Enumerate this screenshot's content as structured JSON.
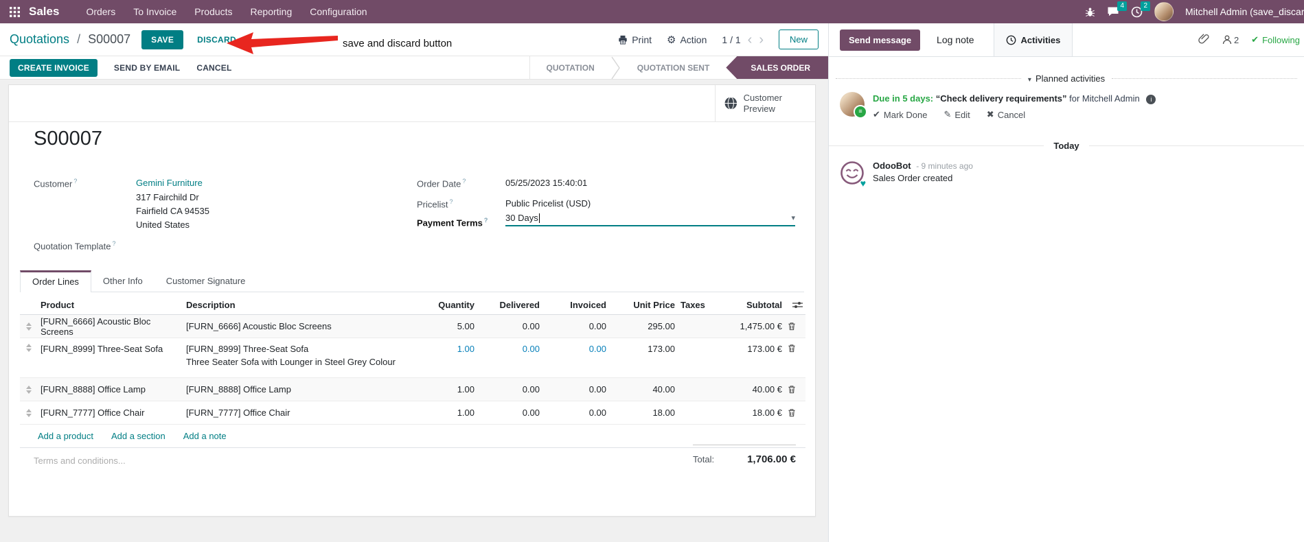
{
  "colors": {
    "brand": "#714B67",
    "accent_teal": "#017E84",
    "badge_teal": "#00A09D",
    "modified_blue": "#0880BA",
    "due_green": "#28a745",
    "arrow_red": "#E8261F"
  },
  "nav": {
    "app": "Sales",
    "menus": [
      "Orders",
      "To Invoice",
      "Products",
      "Reporting",
      "Configuration"
    ],
    "message_badge": "4",
    "activity_badge": "2",
    "user": "Mitchell Admin (save_discar"
  },
  "control": {
    "breadcrumb_parent": "Quotations",
    "breadcrumb_sep": "/",
    "breadcrumb_current": "S00007",
    "save": "SAVE",
    "discard": "DISCARD",
    "print": "Print",
    "action": "Action",
    "pager": "1 / 1",
    "prev": "‹",
    "next": "›",
    "new": "New"
  },
  "annotation": {
    "label": "save and discard button"
  },
  "actions": {
    "create_invoice": "CREATE INVOICE",
    "send_by_email": "SEND BY EMAIL",
    "cancel": "CANCEL"
  },
  "statusbar": {
    "stages": [
      "QUOTATION",
      "QUOTATION SENT",
      "SALES ORDER"
    ],
    "active": "SALES ORDER"
  },
  "form": {
    "customer_preview": "Customer Preview",
    "help": "?",
    "name": "S00007",
    "customer": {
      "label": "Customer",
      "name": "Gemini Furniture",
      "address1": "317 Fairchild Dr",
      "address2": "Fairfield CA 94535",
      "address3": "United States"
    },
    "quotation_template_label": "Quotation Template",
    "order_date": {
      "label": "Order Date",
      "value": "05/25/2023 15:40:01"
    },
    "pricelist": {
      "label": "Pricelist",
      "value": "Public Pricelist (USD)"
    },
    "payment_terms": {
      "label": "Payment Terms",
      "value": "30 Days",
      "caret": "▾"
    },
    "tabs": [
      "Order Lines",
      "Other Info",
      "Customer Signature"
    ]
  },
  "table": {
    "headers": {
      "product": "Product",
      "description": "Description",
      "quantity": "Quantity",
      "delivered": "Delivered",
      "invoiced": "Invoiced",
      "unit_price": "Unit Price",
      "taxes": "Taxes",
      "subtotal": "Subtotal"
    },
    "rows": [
      {
        "product": "[FURN_6666] Acoustic Bloc Screens",
        "description": "[FURN_6666] Acoustic Bloc Screens",
        "quantity": "5.00",
        "delivered": "0.00",
        "invoiced": "0.00",
        "unit_price": "295.00",
        "subtotal": "1,475.00 €"
      },
      {
        "product": "[FURN_8999] Three-Seat Sofa",
        "description": "[FURN_8999] Three-Seat Sofa",
        "description2": "Three Seater Sofa with Lounger in Steel Grey Colour",
        "quantity": "1.00",
        "delivered": "0.00",
        "invoiced": "0.00",
        "unit_price": "173.00",
        "subtotal": "173.00 €"
      },
      {
        "product": "[FURN_8888] Office Lamp",
        "description": "[FURN_8888] Office Lamp",
        "quantity": "1.00",
        "delivered": "0.00",
        "invoiced": "0.00",
        "unit_price": "40.00",
        "subtotal": "40.00 €"
      },
      {
        "product": "[FURN_7777] Office Chair",
        "description": "[FURN_7777] Office Chair",
        "quantity": "1.00",
        "delivered": "0.00",
        "invoiced": "0.00",
        "unit_price": "18.00",
        "subtotal": "18.00 €"
      }
    ],
    "links": [
      "Add a product",
      "Add a section",
      "Add a note"
    ],
    "terms_placeholder": "Terms and conditions...",
    "total_label": "Total:",
    "total_value": "1,706.00 €"
  },
  "chatter": {
    "send_message": "Send message",
    "log_note": "Log note",
    "activities": "Activities",
    "followers": "2",
    "following": "Following",
    "planned_title": "Planned activities",
    "caret": "▾",
    "activity": {
      "due": "Due in 5 days:",
      "title": "“Check delivery requirements”",
      "assignee": "for Mitchell Admin",
      "mark_done": "Mark Done",
      "edit": "Edit",
      "cancel": "Cancel"
    },
    "today": "Today",
    "message": {
      "author": "OdooBot",
      "time": "- 9 minutes ago",
      "body": "Sales Order created"
    }
  }
}
